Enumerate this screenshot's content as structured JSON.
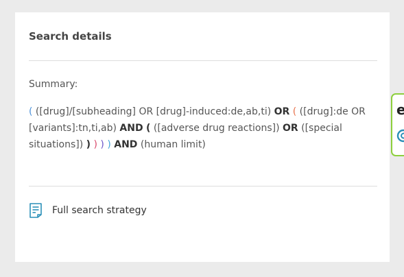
{
  "card": {
    "title": "Search details",
    "summary_label": "Summary:",
    "query": [
      {
        "text": "(",
        "cls": "p-blue"
      },
      {
        "text": " ([drug]/[subheading] OR [drug]-induced:de,ab,ti) ",
        "cls": ""
      },
      {
        "text": "OR",
        "cls": "op"
      },
      {
        "text": " ",
        "cls": ""
      },
      {
        "text": "(",
        "cls": "p-orange"
      },
      {
        "text": " ([drug]:de OR [variants]:tn,ti,ab) ",
        "cls": ""
      },
      {
        "text": "AND",
        "cls": "op"
      },
      {
        "text": " ",
        "cls": ""
      },
      {
        "text": "(",
        "cls": "op"
      },
      {
        "text": " ([adverse drug reactions]) ",
        "cls": ""
      },
      {
        "text": "OR",
        "cls": "op"
      },
      {
        "text": " ([special situations]) ",
        "cls": ""
      },
      {
        "text": ")",
        "cls": "op"
      },
      {
        "text": " ",
        "cls": ""
      },
      {
        "text": ")",
        "cls": "p-pink"
      },
      {
        "text": " ",
        "cls": ""
      },
      {
        "text": ")",
        "cls": "p-purple"
      },
      {
        "text": " ",
        "cls": ""
      },
      {
        "text": ")",
        "cls": "p-cyan"
      },
      {
        "text": " ",
        "cls": ""
      },
      {
        "text": "AND",
        "cls": "op"
      },
      {
        "text": " (human limit)",
        "cls": ""
      }
    ],
    "full_strategy_label": "Full search strategy"
  },
  "side_widget": {
    "glyph": "e"
  },
  "colors": {
    "page_bg": "#ebebeb",
    "card_bg": "#ffffff",
    "divider": "#dddddd",
    "icon_teal": "#2a8fb8",
    "widget_border": "#8ccf3c"
  },
  "icons": {
    "full_strategy": "document-list-icon",
    "side_widget_bottom": "circle-c-icon"
  }
}
